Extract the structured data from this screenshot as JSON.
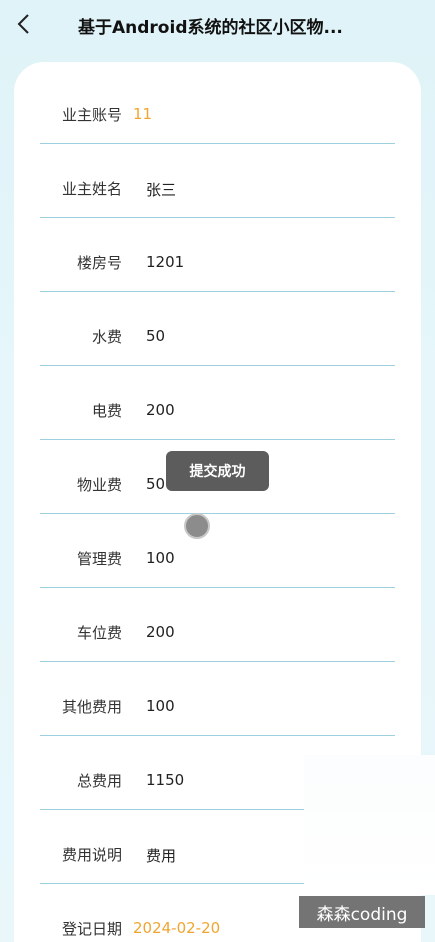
{
  "header": {
    "title": "基于Android系统的社区小区物..."
  },
  "form": {
    "rows": [
      {
        "label": "业主账号",
        "value": "11"
      },
      {
        "label": "业主姓名",
        "value": "张三"
      },
      {
        "label": "楼房号",
        "value": "1201"
      },
      {
        "label": "水费",
        "value": "50"
      },
      {
        "label": "电费",
        "value": "200"
      },
      {
        "label": "物业费",
        "value": "500"
      },
      {
        "label": "管理费",
        "value": "100"
      },
      {
        "label": "车位费",
        "value": "200"
      },
      {
        "label": "其他费用",
        "value": "100"
      },
      {
        "label": "总费用",
        "value": "1150"
      },
      {
        "label": "费用说明",
        "value": "费用"
      },
      {
        "label": "登记日期",
        "value": "2024-02-20"
      }
    ]
  },
  "toast": {
    "message": "提交成功"
  },
  "watermark": {
    "text": "森森coding"
  },
  "colors": {
    "accent": "#f1a530",
    "divider": "#9fd0df"
  }
}
